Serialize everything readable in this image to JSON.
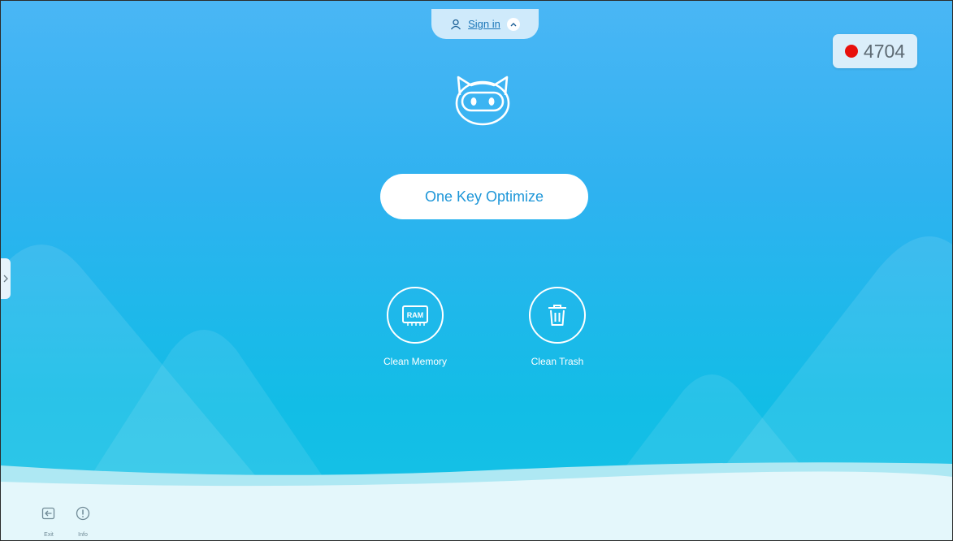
{
  "colors": {
    "background_top": "#4ab6f5",
    "background_bottom": "#16c3e6",
    "accent": "#1d96d8",
    "record_dot": "#e8100c",
    "ground": "#e4f7fb"
  },
  "header": {
    "signin_label": "Sign in",
    "person_icon": "person-icon",
    "chevron_icon": "chevron-up-icon"
  },
  "counter": {
    "value": "4704",
    "dot_icon": "record-dot"
  },
  "main": {
    "mascot_icon": "robot-cat-mascot",
    "optimize_label": "One Key Optimize",
    "tools": [
      {
        "label": "Clean Memory",
        "icon": "ram-chip-icon",
        "icon_text": "RAM"
      },
      {
        "label": "Clean Trash",
        "icon": "trash-icon"
      }
    ]
  },
  "sidebar": {
    "handle_icon": "chevron-right-icon"
  },
  "footer": {
    "buttons": [
      {
        "label": "Exit",
        "icon": "exit-icon"
      },
      {
        "label": "Info",
        "icon": "info-icon"
      }
    ]
  }
}
